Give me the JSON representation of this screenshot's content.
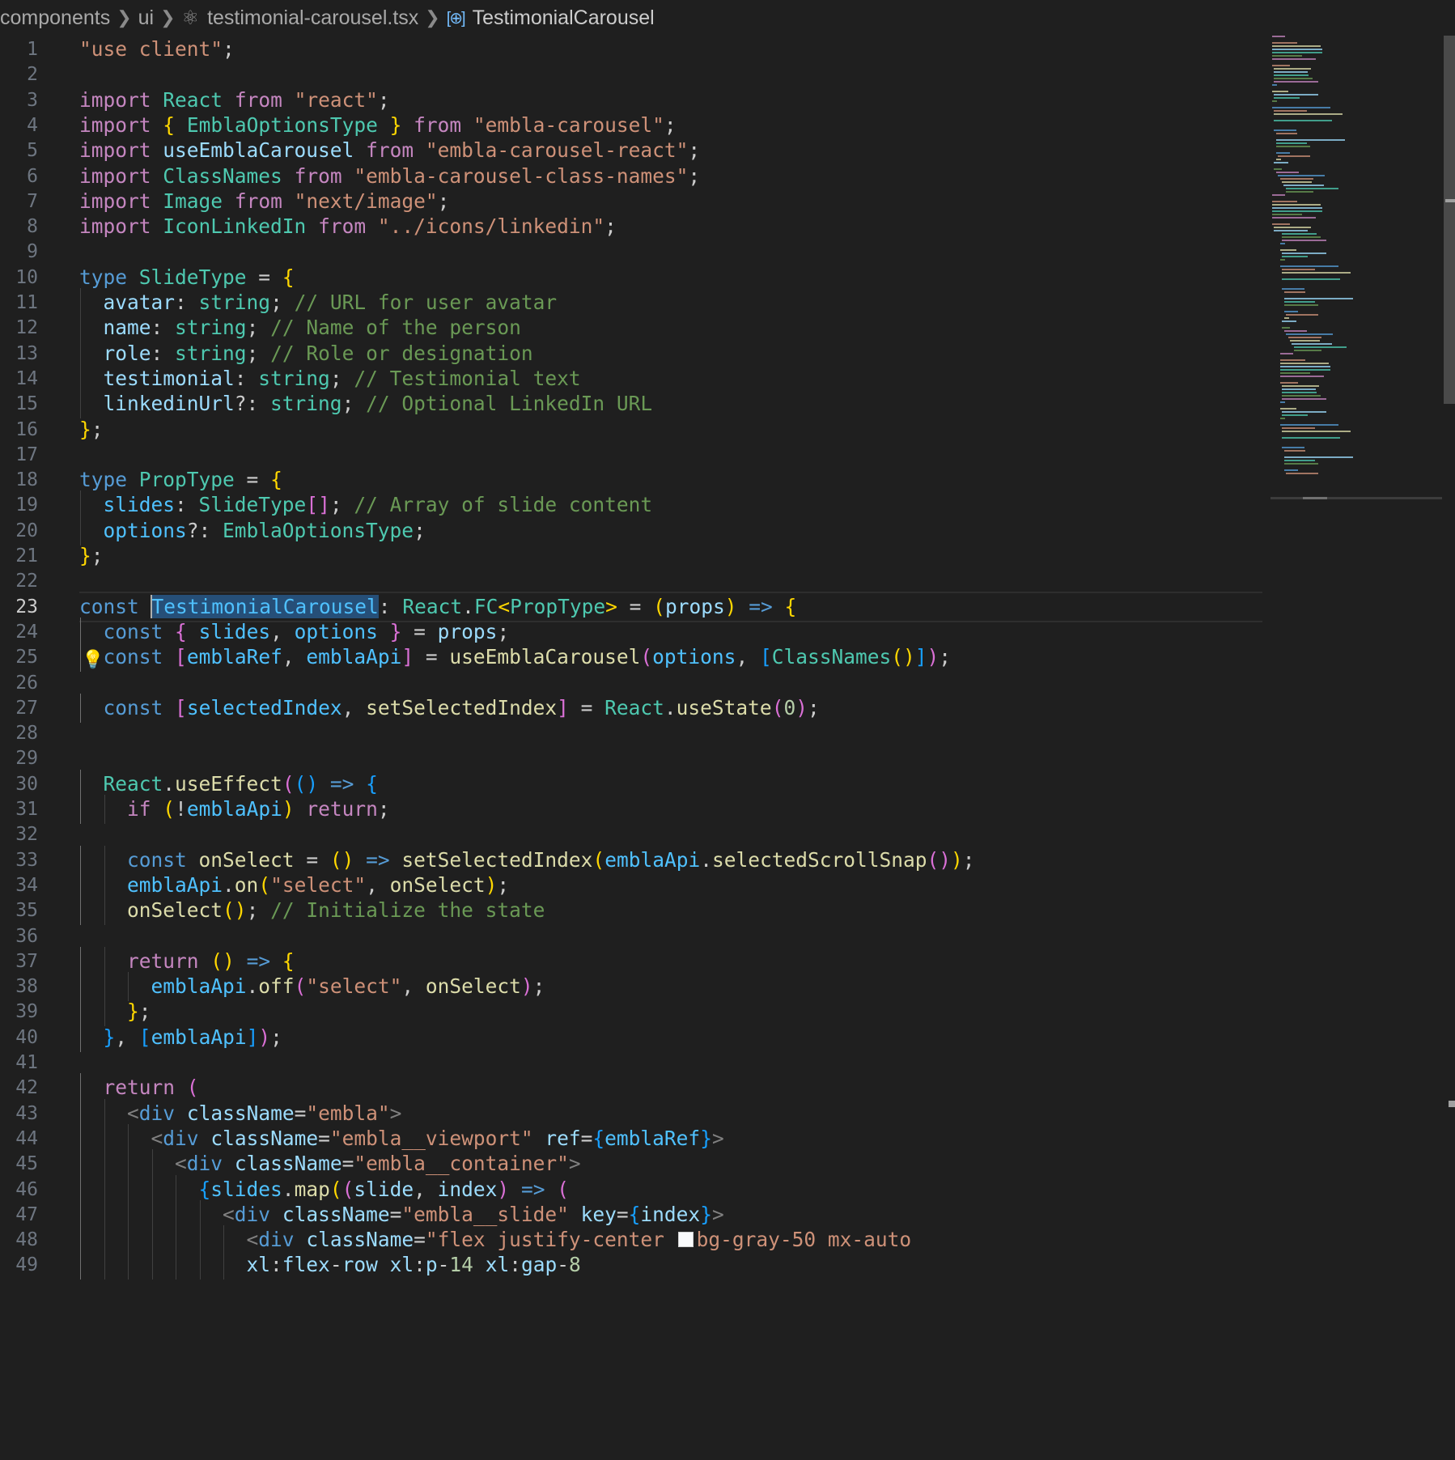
{
  "breadcrumb": {
    "items": [
      "components",
      "ui",
      "testimonial-carousel.tsx",
      "TestimonialCarousel"
    ]
  },
  "icons": {
    "file_icon": "react-icon",
    "symbol_icon": "symbol-variable-icon",
    "lightbulb": "lightbulb-icon"
  },
  "editor": {
    "current_line": 23,
    "selected_text": "TestimonialCarousel",
    "theme": {
      "background": "#1f1f1f",
      "keyword": "#569cd6",
      "control_keyword": "#c586c0",
      "type": "#4ec9b0",
      "string": "#ce9178",
      "comment": "#6a9955",
      "function": "#dcdcaa",
      "variable": "#9cdcfe",
      "bracket_gold": "#ffd700",
      "bracket_orchid": "#da70d6",
      "bracket_blue": "#179fff"
    },
    "lines": [
      {
        "n": "1",
        "t": "\"use client\";"
      },
      {
        "n": "2",
        "t": ""
      },
      {
        "n": "3",
        "t": "import React from \"react\";"
      },
      {
        "n": "4",
        "t": "import { EmblaOptionsType } from \"embla-carousel\";"
      },
      {
        "n": "5",
        "t": "import useEmblaCarousel from \"embla-carousel-react\";"
      },
      {
        "n": "6",
        "t": "import ClassNames from \"embla-carousel-class-names\";"
      },
      {
        "n": "7",
        "t": "import Image from \"next/image\";"
      },
      {
        "n": "8",
        "t": "import IconLinkedIn from \"../icons/linkedin\";"
      },
      {
        "n": "9",
        "t": ""
      },
      {
        "n": "10",
        "t": "type SlideType = {"
      },
      {
        "n": "11",
        "t": "  avatar: string; // URL for user avatar"
      },
      {
        "n": "12",
        "t": "  name: string; // Name of the person"
      },
      {
        "n": "13",
        "t": "  role: string; // Role or designation"
      },
      {
        "n": "14",
        "t": "  testimonial: string; // Testimonial text"
      },
      {
        "n": "15",
        "t": "  linkedinUrl?: string; // Optional LinkedIn URL"
      },
      {
        "n": "16",
        "t": "};"
      },
      {
        "n": "17",
        "t": ""
      },
      {
        "n": "18",
        "t": "type PropType = {"
      },
      {
        "n": "19",
        "t": "  slides: SlideType[]; // Array of slide content"
      },
      {
        "n": "20",
        "t": "  options?: EmblaOptionsType;"
      },
      {
        "n": "21",
        "t": "};"
      },
      {
        "n": "22",
        "t": ""
      },
      {
        "n": "23",
        "t": "const TestimonialCarousel: React.FC<PropType> = (props) => {"
      },
      {
        "n": "24",
        "t": "  const { slides, options } = props;"
      },
      {
        "n": "25",
        "t": "  const [emblaRef, emblaApi] = useEmblaCarousel(options, [ClassNames()]);"
      },
      {
        "n": "26",
        "t": ""
      },
      {
        "n": "27",
        "t": "  const [selectedIndex, setSelectedIndex] = React.useState(0);"
      },
      {
        "n": "28",
        "t": ""
      },
      {
        "n": "29",
        "t": ""
      },
      {
        "n": "30",
        "t": "  React.useEffect(() => {"
      },
      {
        "n": "31",
        "t": "    if (!emblaApi) return;"
      },
      {
        "n": "32",
        "t": ""
      },
      {
        "n": "33",
        "t": "    const onSelect = () => setSelectedIndex(emblaApi.selectedScrollSnap());"
      },
      {
        "n": "34",
        "t": "    emblaApi.on(\"select\", onSelect);"
      },
      {
        "n": "35",
        "t": "    onSelect(); // Initialize the state"
      },
      {
        "n": "36",
        "t": ""
      },
      {
        "n": "37",
        "t": "    return () => {"
      },
      {
        "n": "38",
        "t": "      emblaApi.off(\"select\", onSelect);"
      },
      {
        "n": "39",
        "t": "    };"
      },
      {
        "n": "40",
        "t": "  }, [emblaApi]);"
      },
      {
        "n": "41",
        "t": ""
      },
      {
        "n": "42",
        "t": "  return ("
      },
      {
        "n": "43",
        "t": "    <div className=\"embla\">"
      },
      {
        "n": "44",
        "t": "      <div className=\"embla__viewport\" ref={emblaRef}>"
      },
      {
        "n": "45",
        "t": "        <div className=\"embla__container\">"
      },
      {
        "n": "46",
        "t": "          {slides.map((slide, index) => ("
      },
      {
        "n": "47",
        "t": "            <div className=\"embla__slide\" key={index}>"
      },
      {
        "n": "48",
        "t": "              <div className=\"flex justify-center bg-gray-50 mx-auto"
      },
      {
        "n": "49",
        "t": "              xl:flex-row xl:p-14 xl:gap-8"
      }
    ]
  }
}
